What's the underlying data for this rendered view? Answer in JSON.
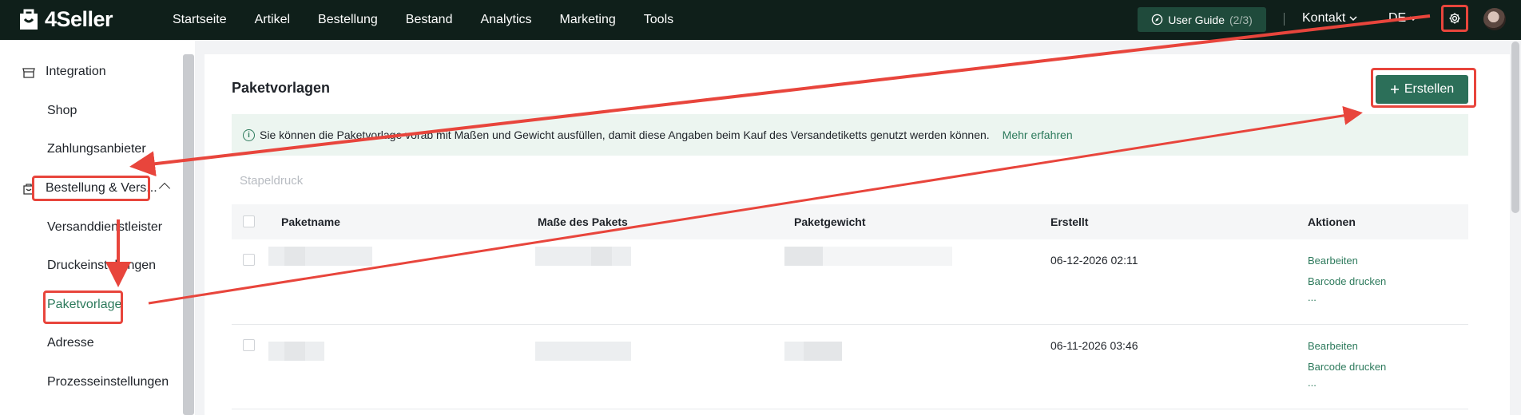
{
  "app": {
    "name": "4Seller"
  },
  "nav": {
    "items": [
      "Startseite",
      "Artikel",
      "Bestellung",
      "Bestand",
      "Analytics",
      "Marketing",
      "Tools"
    ],
    "guide_label": "User Guide",
    "guide_count": "(2/3)",
    "contact_label": "Kontakt",
    "language": "DE"
  },
  "sidebar": {
    "group1": "Integration",
    "items1": [
      "Shop",
      "Zahlungsanbieter"
    ],
    "group2": "Bestellung & Vers...",
    "items2": [
      "Versanddienstleister",
      "Druckeinstellungen",
      "Paketvorlage",
      "Adresse",
      "Prozesseinstellungen"
    ]
  },
  "page": {
    "title": "Paketvorlagen",
    "create_label": "Erstellen",
    "info_text": "Sie können die Paketvorlage vorab mit Maßen und Gewicht ausfüllen, damit diese Angaben beim Kauf des Versandetiketts genutzt werden können.",
    "info_link": "Mehr erfahren",
    "batch_print": "Stapeldruck"
  },
  "table": {
    "columns": [
      "Paketname",
      "Maße des Pakets",
      "Paketgewicht",
      "Erstellt",
      "Aktionen"
    ],
    "rows": [
      {
        "created": "06-12-2026 02:11",
        "actions": [
          "Bearbeiten",
          "Barcode drucken",
          "..."
        ]
      },
      {
        "created": "06-11-2026 03:46",
        "actions": [
          "Bearbeiten",
          "Barcode drucken",
          "..."
        ]
      }
    ]
  },
  "colors": {
    "topbar": "#0f1f1a",
    "accent": "#2c6f59",
    "annotation": "#e8453c"
  }
}
